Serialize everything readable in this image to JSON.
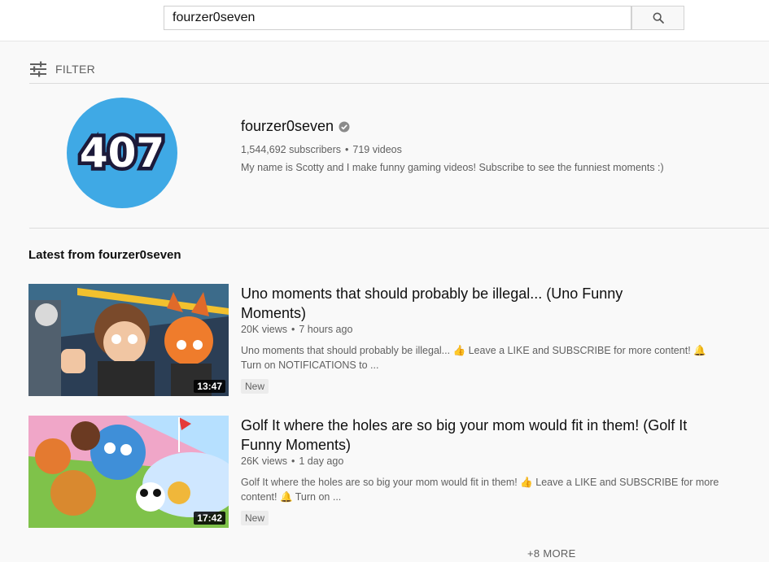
{
  "search": {
    "query": "fourzer0seven"
  },
  "filter": {
    "label": "FILTER"
  },
  "channel": {
    "name": "fourzer0seven",
    "subscribers": "1,544,692 subscribers",
    "videos": "719 videos",
    "description": "My name is Scotty and I make funny gaming videos! Subscribe to see the funniest moments :)",
    "avatar_text": "407",
    "avatar_color": "#3fa9e5"
  },
  "section": {
    "title": "Latest from fourzer0seven"
  },
  "videos": [
    {
      "title": "Uno moments that should probably be illegal... (Uno Funny Moments)",
      "views": "20K views",
      "age": "7 hours ago",
      "description_line1": "Uno moments that should probably be illegal... 👍 Leave a LIKE and SUBSCRIBE for more content! 🔔",
      "description_line2": "Turn on NOTIFICATIONS to ...",
      "badge": "New",
      "duration": "13:47"
    },
    {
      "title": "Golf It where the holes are so big your mom would fit in them! (Golf It Funny Moments)",
      "views": "26K views",
      "age": "1 day ago",
      "description_line1": "Golf It where the holes are so big your mom would fit in them! 👍 Leave a LIKE and SUBSCRIBE for more",
      "description_line2": "content! 🔔 Turn on ...",
      "badge": "New",
      "duration": "17:42"
    }
  ],
  "more": {
    "label": "+8 MORE"
  },
  "icons": {
    "search": "search-icon",
    "filter": "filter-sliders-icon",
    "verified": "verified-check-icon"
  }
}
